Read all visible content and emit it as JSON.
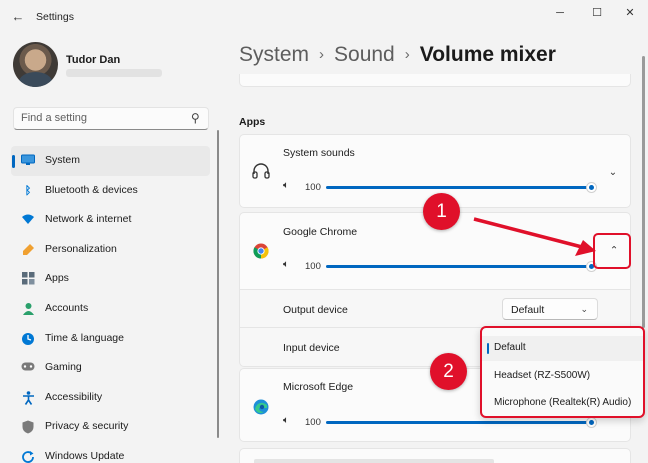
{
  "window": {
    "title": "Settings",
    "back_icon": "arrow-left-icon",
    "controls": {
      "minimize": "─",
      "maximize": "☐",
      "close": "✕"
    }
  },
  "profile": {
    "name": "Tudor Dan"
  },
  "search": {
    "placeholder": "Find a setting",
    "icon": "search-icon"
  },
  "sidebar": {
    "items": [
      {
        "label": "System",
        "icon": "display-icon",
        "color": "#0067c0",
        "active": true
      },
      {
        "label": "Bluetooth & devices",
        "icon": "bluetooth-icon",
        "color": "#0078d4"
      },
      {
        "label": "Network & internet",
        "icon": "wifi-icon",
        "color": "#0078d4"
      },
      {
        "label": "Personalization",
        "icon": "brush-icon",
        "color": "#e58a00"
      },
      {
        "label": "Apps",
        "icon": "apps-icon",
        "color": "#5a6b7a"
      },
      {
        "label": "Accounts",
        "icon": "person-icon",
        "color": "#2aa06b"
      },
      {
        "label": "Time & language",
        "icon": "clock-globe-icon",
        "color": "#0078d4"
      },
      {
        "label": "Gaming",
        "icon": "controller-icon",
        "color": "#6b6b6b"
      },
      {
        "label": "Accessibility",
        "icon": "accessibility-icon",
        "color": "#0067c0"
      },
      {
        "label": "Privacy & security",
        "icon": "shield-icon",
        "color": "#6b6b6b"
      },
      {
        "label": "Windows Update",
        "icon": "update-icon",
        "color": "#0078d4"
      }
    ]
  },
  "header": {
    "crumb1": "System",
    "crumb2": "Sound",
    "current": "Volume mixer",
    "separator": "›"
  },
  "main": {
    "section_title": "Apps",
    "apps": [
      {
        "name": "System sounds",
        "volume": "100",
        "icon": "headphones-icon",
        "expanded": false
      },
      {
        "name": "Google Chrome",
        "volume": "100",
        "icon": "chrome-icon",
        "expanded": true
      },
      {
        "name": "Microsoft Edge",
        "volume": "100",
        "icon": "edge-icon",
        "expanded": false
      }
    ],
    "output_device": {
      "label": "Output device",
      "value": "Default"
    },
    "input_device": {
      "label": "Input device"
    }
  },
  "input_dropdown": {
    "options": [
      "Default",
      "Headset (RZ-S500W)",
      "Microphone (Realtek(R) Audio)"
    ],
    "selected": "Default"
  },
  "annotations": {
    "badge1": "1",
    "badge2": "2",
    "color": "#e0102a"
  }
}
